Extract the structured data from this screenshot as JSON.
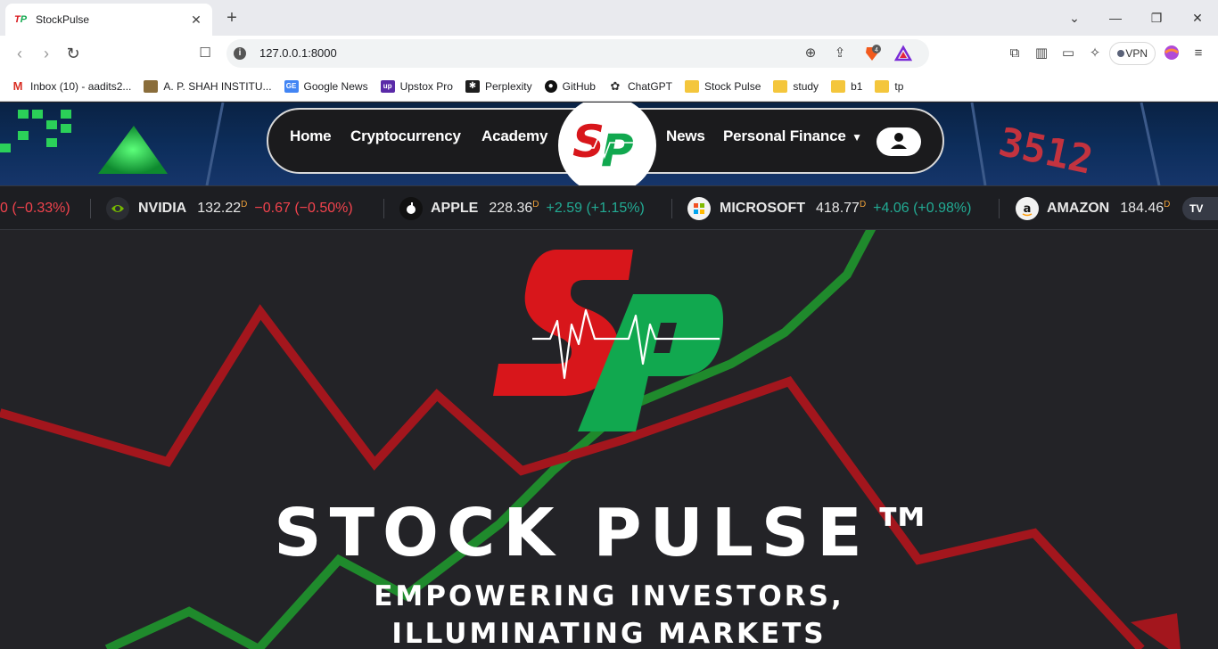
{
  "browser": {
    "tab_title": "StockPulse",
    "url": "127.0.0.1:8000",
    "vpn_label": "VPN",
    "brave_badge": "4",
    "bookmarks": [
      {
        "label": "Inbox (10) - aadits2...",
        "icon": "gmail-icon"
      },
      {
        "label": "A. P. SHAH INSTITU...",
        "icon": "college-icon"
      },
      {
        "label": "Google News",
        "icon": "google-news-icon"
      },
      {
        "label": "Upstox Pro",
        "icon": "upstox-icon"
      },
      {
        "label": "Perplexity",
        "icon": "perplexity-icon"
      },
      {
        "label": "GitHub",
        "icon": "github-icon"
      },
      {
        "label": "ChatGPT",
        "icon": "chatgpt-icon"
      },
      {
        "label": "Stock Pulse",
        "icon": "folder-icon"
      },
      {
        "label": "study",
        "icon": "folder-icon"
      },
      {
        "label": "b1",
        "icon": "folder-icon"
      },
      {
        "label": "tp",
        "icon": "folder-icon"
      }
    ]
  },
  "nav": {
    "home": "Home",
    "crypto": "Cryptocurrency",
    "academy": "Academy",
    "logo": "SP",
    "news": "News",
    "personal_finance": "Personal Finance"
  },
  "ticker": {
    "first_change": "0 (−0.33%)",
    "items": [
      {
        "name": "NVIDIA",
        "price": "132.22",
        "sup": "D",
        "change": "−0.67 (−0.50%)",
        "direction": "down"
      },
      {
        "name": "APPLE",
        "price": "228.36",
        "sup": "D",
        "change": "+2.59 (+1.15%)",
        "direction": "up"
      },
      {
        "name": "MICROSOFT",
        "price": "418.77",
        "sup": "D",
        "change": "+4.06 (+0.98%)",
        "direction": "up"
      },
      {
        "name": "AMAZON",
        "price": "184.46",
        "sup": "D",
        "change": "",
        "direction": "none"
      }
    ],
    "tv_label": "TV"
  },
  "hero": {
    "logo": "SP",
    "title": "STOCK PULSE™",
    "subtitle_line1": "EMPOWERING INVESTORS,",
    "subtitle_line2": "ILLUMINATING MARKETS"
  },
  "colors": {
    "brand_red": "#d8161b",
    "brand_green": "#11a84f",
    "chart_red": "#a3161d",
    "chart_green": "#1f8a2c",
    "ticker_up": "#22ab94",
    "ticker_down": "#f2434d"
  }
}
